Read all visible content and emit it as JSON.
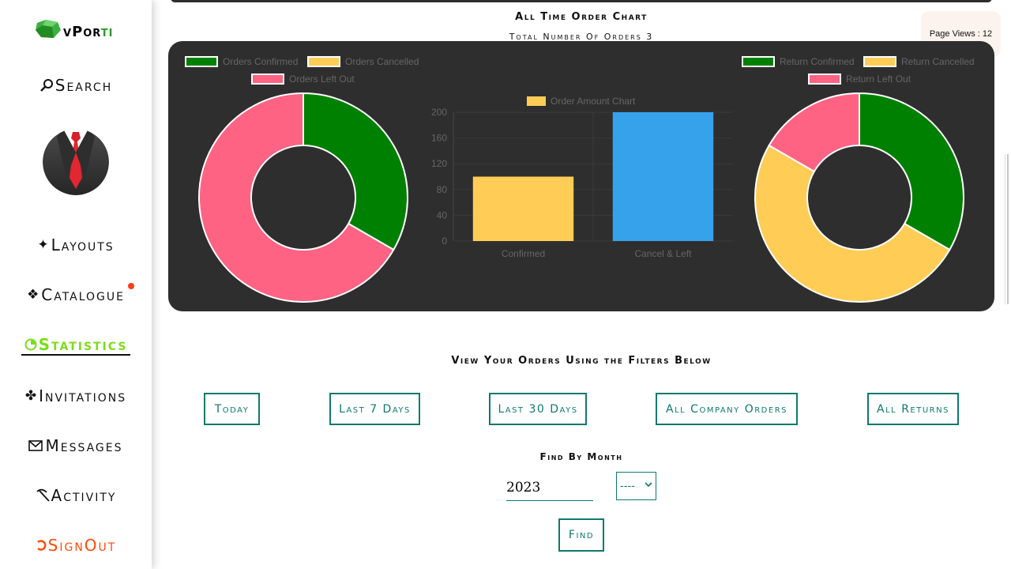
{
  "brand": {
    "part1": "v",
    "part2": "Por",
    "part3": "ti"
  },
  "nav": {
    "search": "Search",
    "layouts": "Layouts",
    "catalogue": "Catalogue",
    "statistics": "Statistics",
    "invitations": "Invitations",
    "messages": "Messages",
    "activity": "Activity",
    "signout": "SignOut"
  },
  "header": {
    "chart_title": "All Time Order Chart",
    "chart_subtitle": "Total Number Of Orders 3",
    "page_views": "Page Views : 12"
  },
  "colors": {
    "confirmed": "#008000",
    "cancelled": "#ffcd56",
    "left_out": "#ff6384",
    "bar_blue": "#36a2eb",
    "accent": "#0d7a6e",
    "stats_active": "#7bde1a",
    "signout": "#ff4a0a"
  },
  "chart_data": [
    {
      "type": "pie",
      "variant": "doughnut",
      "labels": [
        "Orders Confirmed",
        "Orders Cancelled",
        "Orders Left Out"
      ],
      "values": [
        1,
        0,
        2
      ],
      "colors": [
        "#008000",
        "#ffcd56",
        "#ff6384"
      ]
    },
    {
      "type": "bar",
      "categories": [
        "Confirmed",
        "Cancel & Left"
      ],
      "series": [
        {
          "name": "Order Amount Chart",
          "values": [
            100,
            200
          ]
        }
      ],
      "bar_colors": [
        "#ffcd56",
        "#36a2eb"
      ],
      "ylim": [
        0,
        200
      ],
      "yticks": [
        0,
        40,
        80,
        120,
        160,
        200
      ],
      "grid": true
    },
    {
      "type": "pie",
      "variant": "doughnut",
      "labels": [
        "Return Confirmed",
        "Return Cancelled",
        "Return Left Out"
      ],
      "values": [
        1,
        1.5,
        0.5
      ],
      "colors": [
        "#008000",
        "#ffcd56",
        "#ff6384"
      ]
    }
  ],
  "filters": {
    "title": "View Your Orders Using the Filters Below",
    "today": "Today",
    "last7": "Last 7 Days",
    "last30": "Last 30 Days",
    "company": "All Company Orders",
    "returns": "All Returns",
    "month_title": "Find By Month",
    "year_value": "2023",
    "month_selected": "----",
    "find": "Find"
  }
}
